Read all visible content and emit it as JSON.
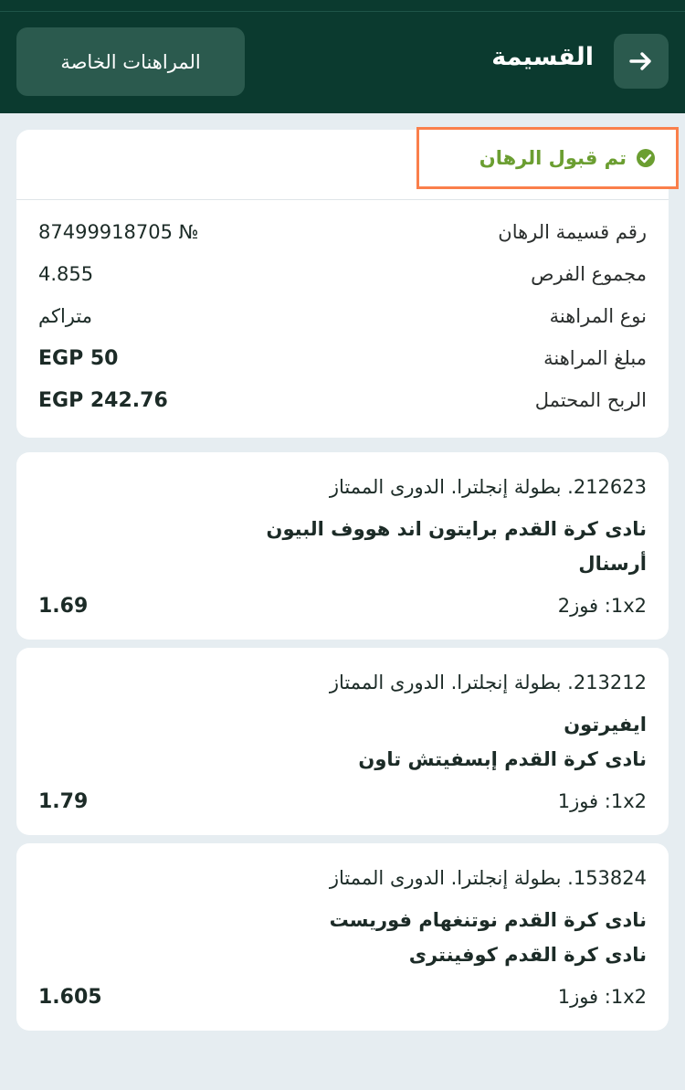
{
  "header": {
    "title": "القسيمة",
    "my_bets_label": "المراهنات الخاصة",
    "back_icon": "arrow-right-icon",
    "bg_color": "#0b3a2f"
  },
  "summary": {
    "status": "تم قبول الرهان",
    "status_color": "#6b9e31",
    "highlight_color": "#fa7f4b",
    "rows": [
      {
        "label": "رقم قسيمة الرهان",
        "value": "87499918705 №"
      },
      {
        "label": "مجموع الفرص",
        "value": "4.855"
      },
      {
        "label": "نوع المراهنة",
        "value": "متراكم"
      },
      {
        "label": "مبلغ المراهنة",
        "value": "EGP 50"
      },
      {
        "label": "الربح المحتمل",
        "value": "EGP 242.76"
      }
    ]
  },
  "selections": [
    {
      "league": "212623. بطولة إنجلترا. الدورى الممتاز",
      "team1": "نادى كرة القدم برايتون اند هووف البيون",
      "team2": "أرسنال",
      "market": "1x2: فوز2",
      "odd": "1.69"
    },
    {
      "league": "213212. بطولة إنجلترا. الدورى الممتاز",
      "team1": "ايفيرتون",
      "team2": "نادى كرة القدم إبسفيتش تاون",
      "market": "1x2: فوز1",
      "odd": "1.79"
    },
    {
      "league": "153824. بطولة إنجلترا. الدورى الممتاز",
      "team1": "نادى كرة القدم نوتنغهام فوريست",
      "team2": "نادى كرة القدم كوفينترى",
      "market": "1x2: فوز1",
      "odd": "1.605"
    }
  ]
}
